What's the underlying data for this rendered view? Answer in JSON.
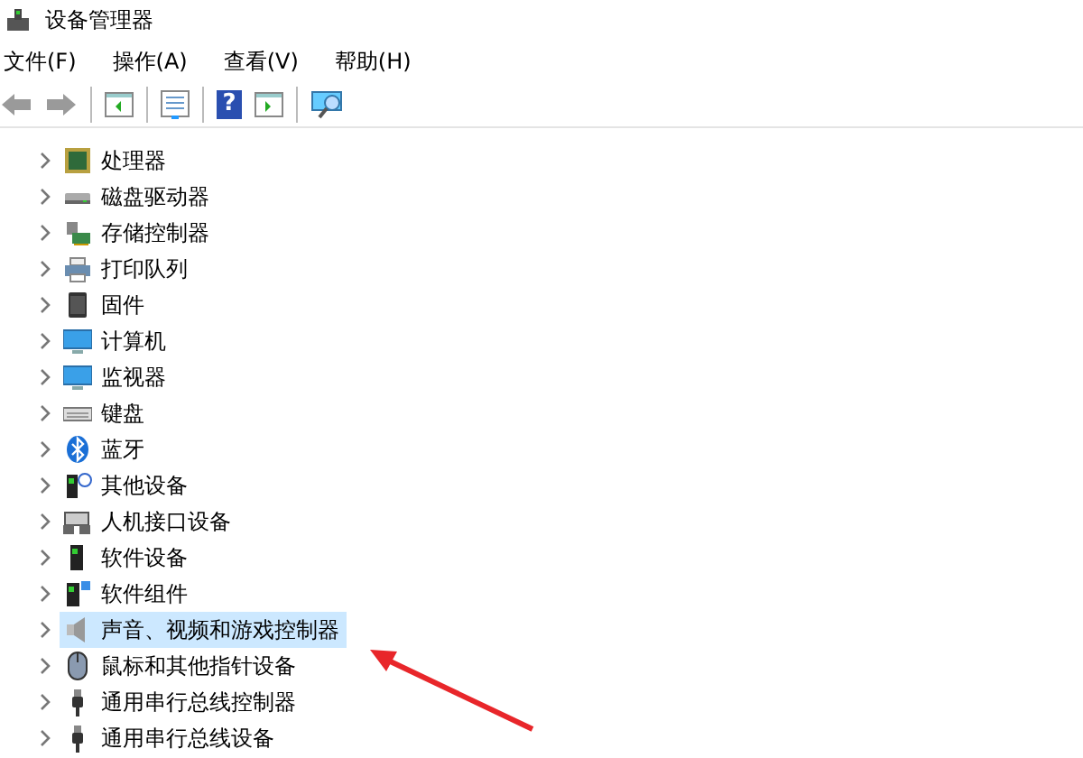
{
  "window": {
    "title": "设备管理器"
  },
  "menu": [
    {
      "label": "文件(F)"
    },
    {
      "label": "操作(A)"
    },
    {
      "label": "查看(V)"
    },
    {
      "label": "帮助(H)"
    }
  ],
  "toolbar": [
    {
      "kind": "back"
    },
    {
      "kind": "forward"
    },
    {
      "kind": "sep"
    },
    {
      "kind": "pane"
    },
    {
      "kind": "sep"
    },
    {
      "kind": "props"
    },
    {
      "kind": "sep"
    },
    {
      "kind": "help",
      "glyph": "?"
    },
    {
      "kind": "run"
    },
    {
      "kind": "sep"
    },
    {
      "kind": "scan"
    }
  ],
  "tree": [
    {
      "label": "处理器",
      "kind": "cpu",
      "expanded": false,
      "selected": false
    },
    {
      "label": "磁盘驱动器",
      "kind": "disk",
      "expanded": false,
      "selected": false
    },
    {
      "label": "存储控制器",
      "kind": "storage",
      "expanded": false,
      "selected": false
    },
    {
      "label": "打印队列",
      "kind": "printer",
      "expanded": false,
      "selected": false
    },
    {
      "label": "固件",
      "kind": "chip",
      "expanded": false,
      "selected": false
    },
    {
      "label": "计算机",
      "kind": "computer",
      "expanded": false,
      "selected": false
    },
    {
      "label": "监视器",
      "kind": "monitor",
      "expanded": false,
      "selected": false
    },
    {
      "label": "键盘",
      "kind": "keyboard",
      "expanded": false,
      "selected": false
    },
    {
      "label": "蓝牙",
      "kind": "bluetooth",
      "expanded": false,
      "selected": false
    },
    {
      "label": "其他设备",
      "kind": "other",
      "expanded": false,
      "selected": false
    },
    {
      "label": "人机接口设备",
      "kind": "hid",
      "expanded": false,
      "selected": false
    },
    {
      "label": "软件设备",
      "kind": "device",
      "expanded": false,
      "selected": false
    },
    {
      "label": "软件组件",
      "kind": "component",
      "expanded": false,
      "selected": false
    },
    {
      "label": "声音、视频和游戏控制器",
      "kind": "speaker",
      "expanded": false,
      "selected": true
    },
    {
      "label": "鼠标和其他指针设备",
      "kind": "mouse",
      "expanded": false,
      "selected": false
    },
    {
      "label": "通用串行总线控制器",
      "kind": "usb",
      "expanded": false,
      "selected": false
    },
    {
      "label": "通用串行总线设备",
      "kind": "usb",
      "expanded": false,
      "selected": false
    }
  ]
}
